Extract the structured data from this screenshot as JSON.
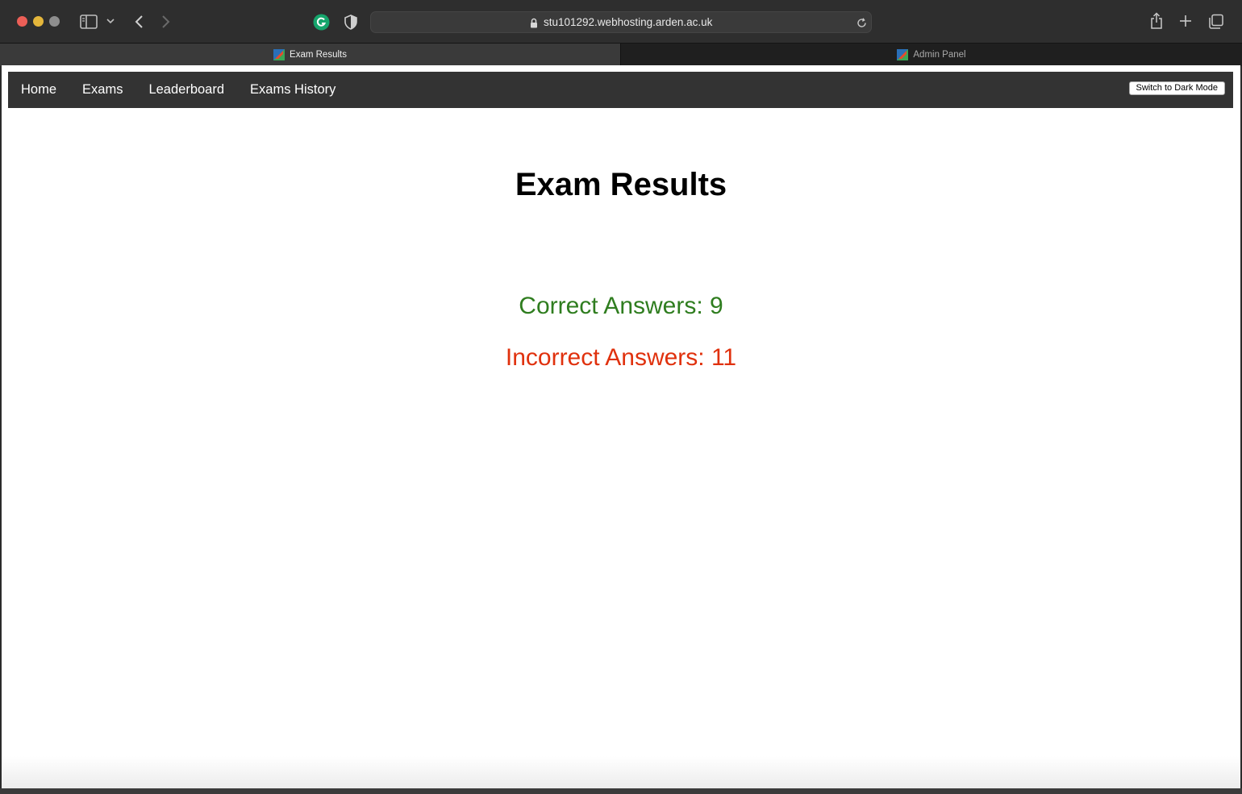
{
  "browser": {
    "url": "stu101292.webhosting.arden.ac.uk",
    "tabs": [
      {
        "label": "Exam Results",
        "active": true
      },
      {
        "label": "Admin Panel",
        "active": false
      }
    ]
  },
  "nav": {
    "links": [
      "Home",
      "Exams",
      "Leaderboard",
      "Exams History"
    ],
    "dark_mode_button": "Switch to Dark Mode"
  },
  "main": {
    "title": "Exam Results",
    "correct_text": "Correct Answers: 9",
    "incorrect_text": "Incorrect Answers: 11"
  },
  "colors": {
    "correct": "#2f7d1f",
    "incorrect": "#e0310d",
    "navbar": "#333333"
  }
}
